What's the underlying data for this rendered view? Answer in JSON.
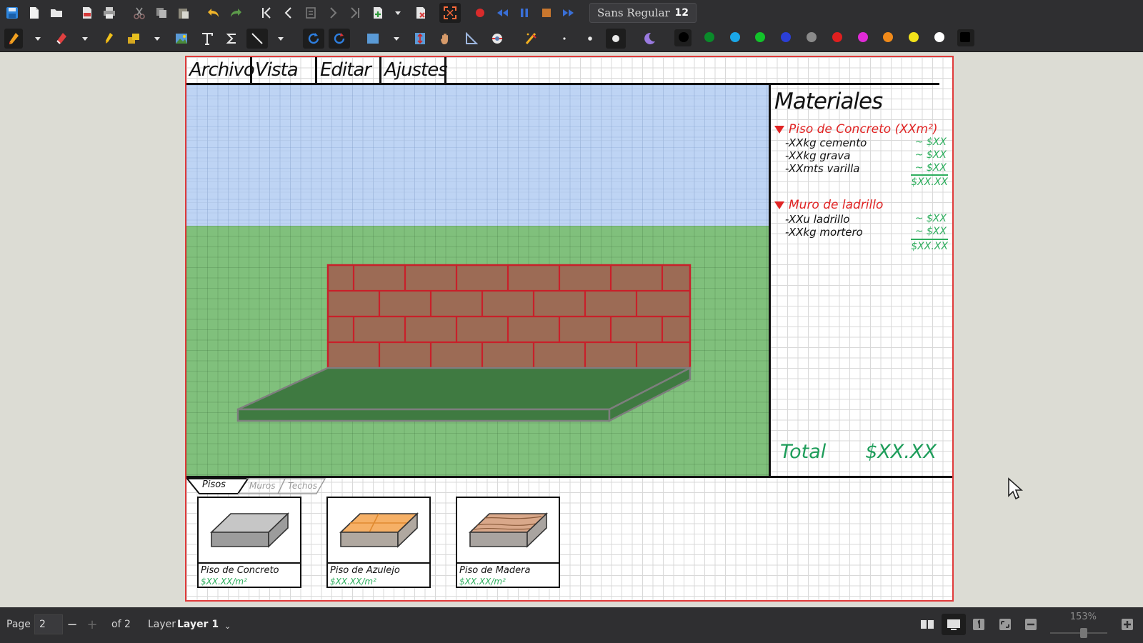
{
  "toolbar": {
    "font_name": "Sans Regular",
    "font_size": "12",
    "color_palette": [
      "#000000",
      "#0a8a2a",
      "#1aa7e8",
      "#12c32a",
      "#2b3fd6",
      "#8a8a8a",
      "#e01f1f",
      "#e02ad6",
      "#f08a1a",
      "#f2e21a",
      "#ffffff",
      "#000000"
    ],
    "icons_row1": [
      "save-icon",
      "new-document-icon",
      "open-folder-icon",
      "export-pdf-icon",
      "print-icon",
      "cut-icon",
      "copy-icon",
      "paste-icon",
      "undo-icon",
      "redo-icon",
      "first-page-icon",
      "previous-page-icon",
      "goto-page-icon",
      "next-page-icon",
      "last-page-icon",
      "add-page-icon",
      "delete-page-icon",
      "fullscreen-icon",
      "record-icon",
      "rewind-icon",
      "pause-icon",
      "stop-icon",
      "fast-forward-icon"
    ],
    "icons_row2": [
      "pen-icon",
      "eraser-icon",
      "highlighter-icon",
      "shape-fill-icon",
      "image-icon",
      "text-icon",
      "math-icon",
      "line-icon",
      "rotate-icon",
      "redraw-icon",
      "select-rect-icon",
      "vertical-space-icon",
      "hand-icon",
      "ruler-icon",
      "compass-icon",
      "laser-icon",
      "dot-small-icon",
      "dot-medium-icon",
      "dot-large-icon",
      "moon-icon"
    ]
  },
  "menu": {
    "items": [
      {
        "label": "Archivo"
      },
      {
        "label": "Vista"
      },
      {
        "label": "Editar"
      },
      {
        "label": "Ajustes"
      }
    ]
  },
  "materials": {
    "title": "Materiales",
    "sections": [
      {
        "name": "Piso de Concreto (XXm²)",
        "items": [
          {
            "label": "-XXkg cemento",
            "price": "~ $XX"
          },
          {
            "label": "-XXkg grava",
            "price": "~ $XX"
          },
          {
            "label": "-XXmts varilla",
            "price": "~ $XX"
          }
        ],
        "subtotal": "$XX.XX"
      },
      {
        "name": "Muro de ladrillo",
        "items": [
          {
            "label": "-XXu ladrillo",
            "price": "~ $XX"
          },
          {
            "label": "-XXkg mortero",
            "price": "~ $XX"
          }
        ],
        "subtotal": "$XX.XX"
      }
    ],
    "total_label": "Total",
    "total_value": "$XX.XX"
  },
  "tabs": [
    {
      "label": "Pisos",
      "active": true
    },
    {
      "label": "Muros",
      "active": false
    },
    {
      "label": "Techos",
      "active": false
    }
  ],
  "catalog": [
    {
      "name": "Piso de Concreto",
      "price": "$XX.XX/m²",
      "top_color": "#c6c6c6",
      "side_color": "#9c9c9c"
    },
    {
      "name": "Piso de Azulejo",
      "price": "$XX.XX/m²",
      "top_color": "#f6b066",
      "side_color": "#b0a8a0"
    },
    {
      "name": "Piso de Madera",
      "price": "$XX.XX/m²",
      "top_color": "#d9a88a",
      "side_color": "#a9a4a0"
    }
  ],
  "statusbar": {
    "page_label": "Page",
    "page_value": "2",
    "of_label": "of 2",
    "layer_label": "Layer",
    "layer_value": "Layer 1",
    "zoom": "153%"
  }
}
